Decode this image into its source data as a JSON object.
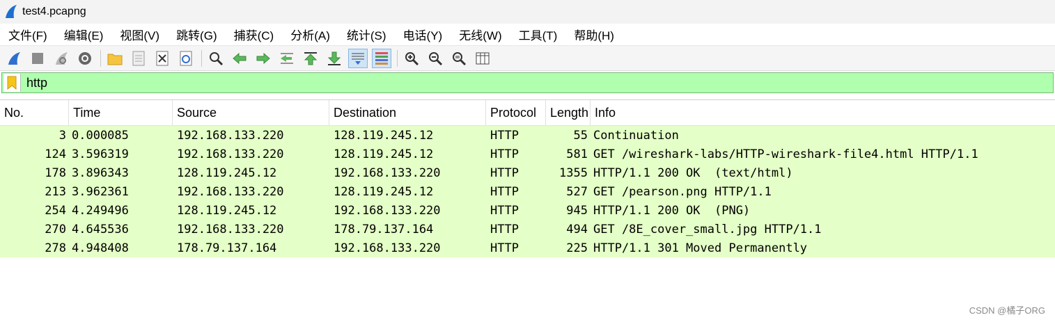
{
  "window": {
    "title": "test4.pcapng"
  },
  "menu": [
    "文件(F)",
    "编辑(E)",
    "视图(V)",
    "跳转(G)",
    "捕获(C)",
    "分析(A)",
    "统计(S)",
    "电话(Y)",
    "无线(W)",
    "工具(T)",
    "帮助(H)"
  ],
  "toolbar": {
    "icons": [
      "shark-fin-start-icon",
      "stop-capture-icon",
      "restart-capture-icon",
      "capture-options-icon",
      "open-file-icon",
      "save-file-icon",
      "close-file-icon",
      "reload-file-icon",
      "find-packet-icon",
      "go-back-icon",
      "go-forward-icon",
      "go-to-packet-icon",
      "go-first-icon",
      "go-last-icon",
      "autoscroll-icon",
      "colorize-icon",
      "zoom-in-icon",
      "zoom-out-icon",
      "zoom-normal-icon",
      "resize-columns-icon"
    ]
  },
  "filter": {
    "value": "http"
  },
  "columns": [
    "No.",
    "Time",
    "Source",
    "Destination",
    "Protocol",
    "Length",
    "Info"
  ],
  "packets": [
    {
      "no": "3",
      "time": "0.000085",
      "source": "192.168.133.220",
      "destination": "128.119.245.12",
      "protocol": "HTTP",
      "length": "55",
      "info": "Continuation"
    },
    {
      "no": "124",
      "time": "3.596319",
      "source": "192.168.133.220",
      "destination": "128.119.245.12",
      "protocol": "HTTP",
      "length": "581",
      "info": "GET /wireshark-labs/HTTP-wireshark-file4.html HTTP/1.1"
    },
    {
      "no": "178",
      "time": "3.896343",
      "source": "128.119.245.12",
      "destination": "192.168.133.220",
      "protocol": "HTTP",
      "length": "1355",
      "info": "HTTP/1.1 200 OK  (text/html)"
    },
    {
      "no": "213",
      "time": "3.962361",
      "source": "192.168.133.220",
      "destination": "128.119.245.12",
      "protocol": "HTTP",
      "length": "527",
      "info": "GET /pearson.png HTTP/1.1"
    },
    {
      "no": "254",
      "time": "4.249496",
      "source": "128.119.245.12",
      "destination": "192.168.133.220",
      "protocol": "HTTP",
      "length": "945",
      "info": "HTTP/1.1 200 OK  (PNG)"
    },
    {
      "no": "270",
      "time": "4.645536",
      "source": "192.168.133.220",
      "destination": "178.79.137.164",
      "protocol": "HTTP",
      "length": "494",
      "info": "GET /8E_cover_small.jpg HTTP/1.1"
    },
    {
      "no": "278",
      "time": "4.948408",
      "source": "178.79.137.164",
      "destination": "192.168.133.220",
      "protocol": "HTTP",
      "length": "225",
      "info": "HTTP/1.1 301 Moved Permanently"
    }
  ],
  "colors": {
    "filter_ok_bg": "#afffaf",
    "http_row_bg": "#e4ffc7",
    "accent": "#2f6fd0"
  },
  "watermark": "CSDN @橘子ORG"
}
